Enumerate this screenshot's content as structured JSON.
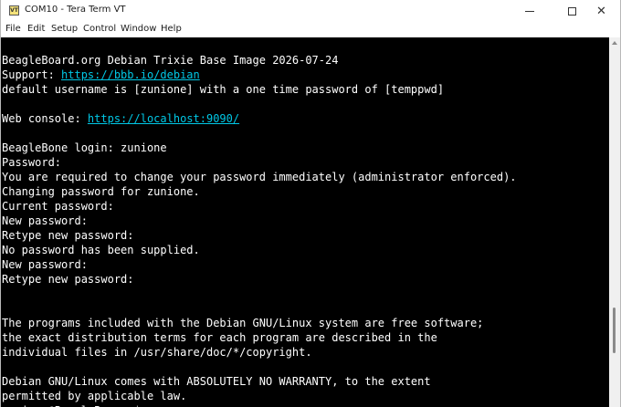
{
  "window": {
    "title": "COM10 - Tera Term VT",
    "icon_label": "VT",
    "icon": "tera-term-icon"
  },
  "menu": [
    "File",
    "Edit",
    "Setup",
    "Control",
    "Window",
    "Help"
  ],
  "terminal": {
    "link_color": "#00c8e6",
    "lines": [
      [
        {
          "t": "BeagleBoard.org Debian Trixie Base Image 2026-07-24"
        }
      ],
      [
        {
          "t": "Support: "
        },
        {
          "t": "https://bbb.io/debian",
          "link": true
        }
      ],
      [
        {
          "t": "default username is [zunione] with a one time password of [temppwd]"
        }
      ],
      [],
      [
        {
          "t": "Web console: "
        },
        {
          "t": "https://localhost:9090/",
          "link": true
        }
      ],
      [],
      [
        {
          "t": "BeagleBone login: zunione"
        }
      ],
      [
        {
          "t": "Password:"
        }
      ],
      [
        {
          "t": "You are required to change your password immediately (administrator enforced)."
        }
      ],
      [
        {
          "t": "Changing password for zunione."
        }
      ],
      [
        {
          "t": "Current password:"
        }
      ],
      [
        {
          "t": "New password:"
        }
      ],
      [
        {
          "t": "Retype new password:"
        }
      ],
      [
        {
          "t": "No password has been supplied."
        }
      ],
      [
        {
          "t": "New password:"
        }
      ],
      [
        {
          "t": "Retype new password:"
        }
      ],
      [],
      [],
      [
        {
          "t": "The programs included with the Debian GNU/Linux system are free software;"
        }
      ],
      [
        {
          "t": "the exact distribution terms for each program are described in the"
        }
      ],
      [
        {
          "t": "individual files in /usr/share/doc/*/copyright."
        }
      ],
      [],
      [
        {
          "t": "Debian GNU/Linux comes with ABSOLUTELY NO WARRANTY, to the extent"
        }
      ],
      [
        {
          "t": "permitted by applicable law."
        }
      ],
      [
        {
          "t": "zunione@BeagleBone:~$"
        }
      ]
    ]
  }
}
